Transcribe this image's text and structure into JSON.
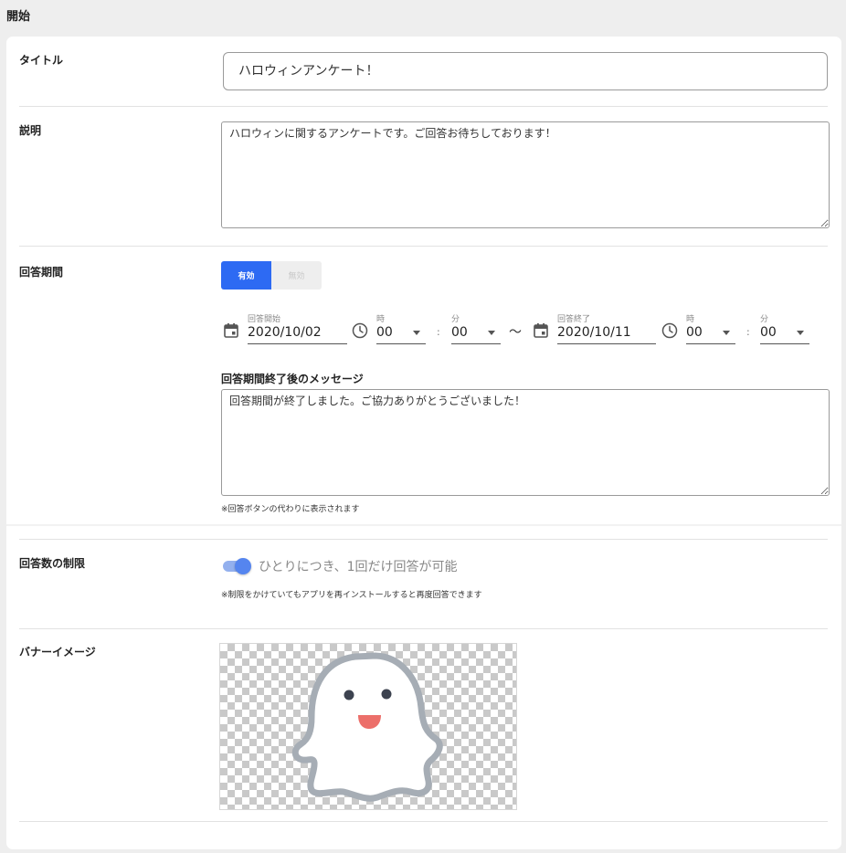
{
  "page": {
    "title": "開始"
  },
  "colors": {
    "accent": "#2d6af3",
    "background": "#eeeeee",
    "card": "#ffffff"
  },
  "form": {
    "title": {
      "label": "タイトル",
      "value": "ハロウィンアンケート！"
    },
    "description": {
      "label": "説明",
      "value": "ハロウィンに関するアンケートです。ご回答お待ちしております！"
    },
    "period": {
      "label": "回答期間",
      "toggle": {
        "on_label": "有効",
        "off_label": "無効",
        "selected": "有効"
      },
      "start": {
        "label": "回答開始",
        "date": "2020/10/02",
        "hour_label": "時",
        "hour": "00",
        "minute_label": "分",
        "minute": "00"
      },
      "range_sep": "〜",
      "time_sep": ":",
      "end": {
        "label": "回答終了",
        "date": "2020/10/11",
        "hour_label": "時",
        "hour": "00",
        "minute_label": "分",
        "minute": "00"
      },
      "after_message": {
        "label": "回答期間終了後のメッセージ",
        "value": "回答期間が終了しました。ご協力ありがとうございました！",
        "hint": "※回答ボタンの代わりに表示されます"
      }
    },
    "limit": {
      "label": "回答数の制限",
      "switch_on": true,
      "switch_label": "ひとりにつき、1回だけ回答が可能",
      "hint": "※制限をかけていてもアプリを再インストールすると再度回答できます"
    },
    "banner": {
      "label": "バナーイメージ",
      "image": "ghost-illustration"
    }
  },
  "icons": {
    "calendar": "calendar-icon",
    "clock": "clock-icon",
    "dropdown": "chevron-down-icon"
  }
}
